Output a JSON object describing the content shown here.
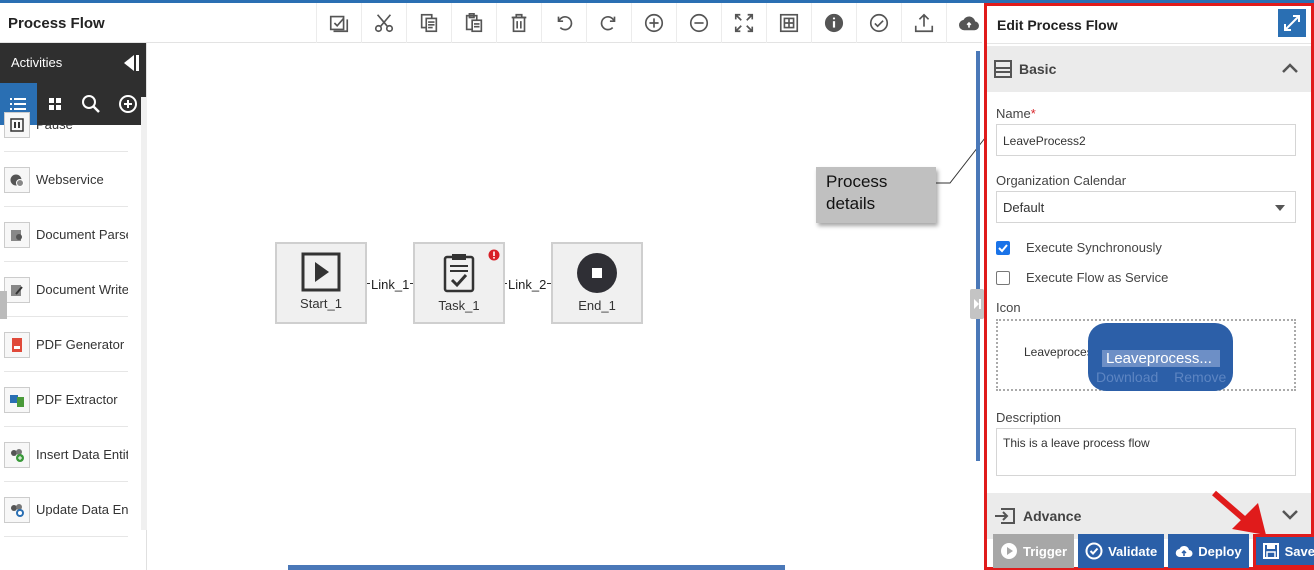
{
  "header": {
    "title": "Process Flow"
  },
  "toolbar": [
    {
      "name": "select-all-icon"
    },
    {
      "name": "cut-icon"
    },
    {
      "name": "copy-icon"
    },
    {
      "name": "paste-icon"
    },
    {
      "name": "delete-icon"
    },
    {
      "name": "undo-icon"
    },
    {
      "name": "redo-icon"
    },
    {
      "name": "zoom-in-icon"
    },
    {
      "name": "zoom-out-icon"
    },
    {
      "name": "fit-screen-icon"
    },
    {
      "name": "grid-icon"
    },
    {
      "name": "info-icon"
    },
    {
      "name": "validate-check-icon"
    },
    {
      "name": "upload-icon"
    },
    {
      "name": "cloud-icon"
    }
  ],
  "sidebar": {
    "title": "Activities",
    "items": [
      {
        "label": "Pause"
      },
      {
        "label": "Webservice"
      },
      {
        "label": "Document Parser"
      },
      {
        "label": "Document Writer"
      },
      {
        "label": "PDF Generator"
      },
      {
        "label": "PDF Extractor"
      },
      {
        "label": "Insert Data Entity"
      },
      {
        "label": "Update Data Entity"
      }
    ]
  },
  "flow": {
    "nodes": [
      {
        "label": "Start_1"
      },
      {
        "label": "Task_1"
      },
      {
        "label": "End_1"
      }
    ],
    "links": [
      "Link_1",
      "Link_2"
    ]
  },
  "callout": {
    "text": "Process details"
  },
  "panel": {
    "title": "Edit Process Flow",
    "basic_label": "Basic",
    "name_label": "Name",
    "name_required": "*",
    "name_value": "LeaveProcess2",
    "calendar_label": "Organization Calendar",
    "calendar_value": "Default",
    "exec_sync_label": "Execute Synchronously",
    "exec_sync_checked": true,
    "exec_service_label": "Execute Flow as Service",
    "exec_service_checked": false,
    "icon_label": "Icon",
    "icon_filename": "Leaveprocess",
    "icon_tooltip": "Leaveprocess...",
    "icon_download": "Download",
    "icon_remove": "Remove",
    "description_label": "Description",
    "description_value": "This is a leave process flow",
    "advance_label": "Advance",
    "buttons": {
      "trigger": "Trigger",
      "validate": "Validate",
      "deploy": "Deploy",
      "save": "Save"
    }
  }
}
